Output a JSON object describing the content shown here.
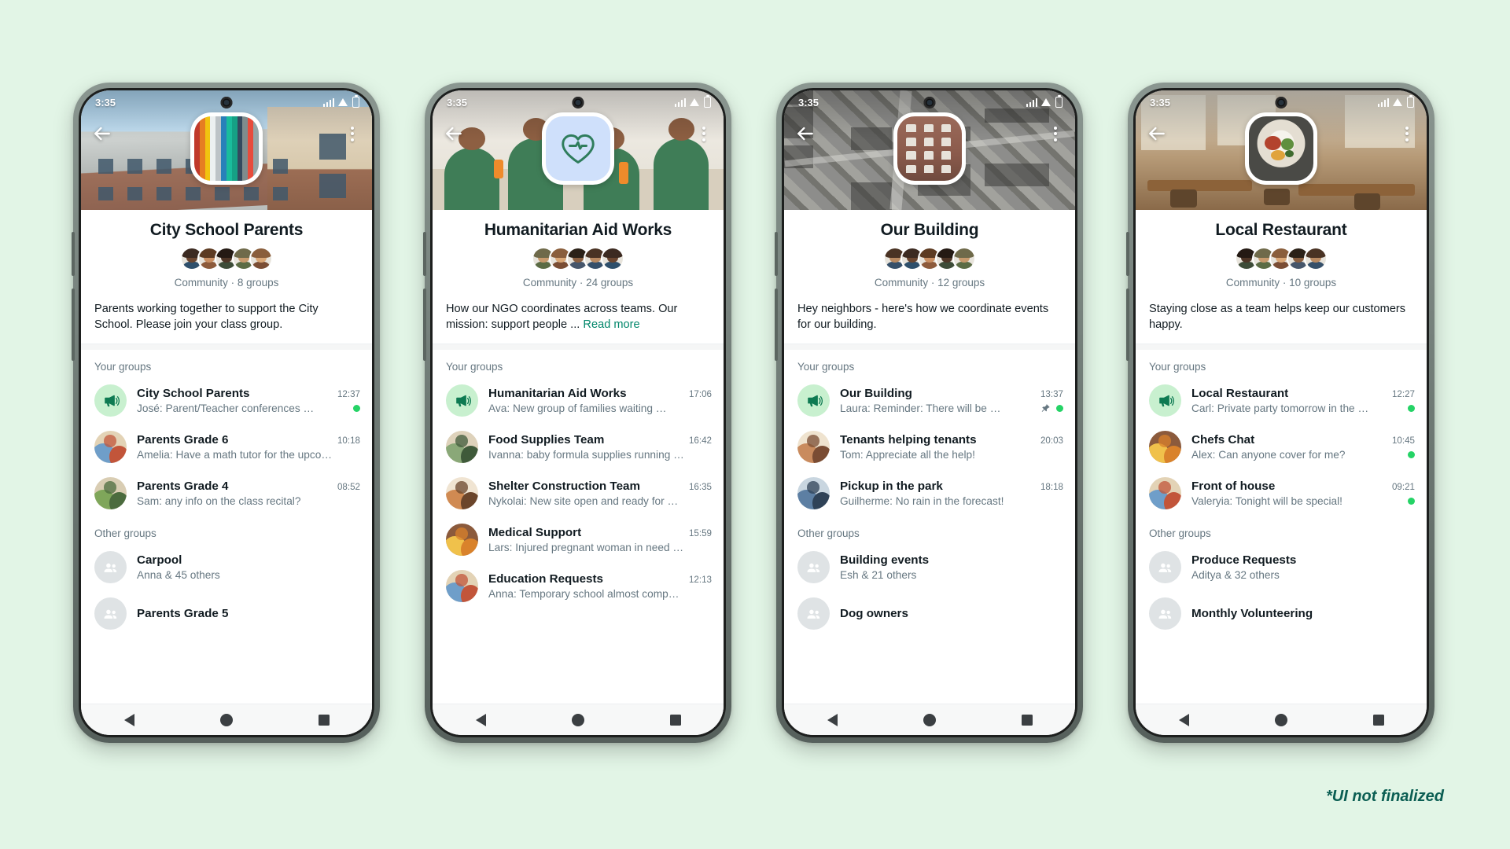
{
  "page": {
    "background_color": "#e2f5e6",
    "disclaimer": "*UI not finalized"
  },
  "status_bar": {
    "time_1": "3:35",
    "time_2": "3:35",
    "time_3": "3:35",
    "time_4": "3:35"
  },
  "icons": {
    "back": "back-arrow-icon",
    "more": "overflow-menu-icon",
    "announce": "megaphone-icon",
    "pin": "pin-icon",
    "group": "group-people-icon",
    "unread": "unread-dot"
  },
  "colors": {
    "accent_green": "#00866a",
    "unread_dot": "#25d366",
    "announce_bg": "#c8f0cf",
    "secondary_text": "#667781",
    "primary_text": "#111b21"
  },
  "labels": {
    "your_groups": "Your groups",
    "other_groups": "Other groups",
    "read_more": "Read more"
  },
  "phones": [
    {
      "id": "city-school-parents",
      "title": "City School Parents",
      "subtitle": "Community · 8 groups",
      "description": "Parents working together to support the City School. Please join your class group.",
      "has_read_more": false,
      "your_groups": [
        {
          "name": "City School Parents",
          "message": "José: Parent/Teacher conferences …",
          "time": "12:37",
          "announce": true,
          "pinned": false,
          "unread": true
        },
        {
          "name": "Parents Grade 6",
          "message": "Amelia: Have a math tutor for the upco…",
          "time": "10:18",
          "announce": false,
          "pinned": false,
          "unread": false
        },
        {
          "name": "Parents Grade 4",
          "message": "Sam: any info on the class recital?",
          "time": "08:52",
          "announce": false,
          "pinned": false,
          "unread": false
        }
      ],
      "other_groups": [
        {
          "name": "Carpool",
          "members": "Anna & 45 others"
        },
        {
          "name": "Parents Grade 5",
          "members": ""
        }
      ]
    },
    {
      "id": "humanitarian-aid-works",
      "title": "Humanitarian Aid Works",
      "subtitle": "Community · 24 groups",
      "description": "How our NGO coordinates across teams. Our mission: support people ...",
      "has_read_more": true,
      "your_groups": [
        {
          "name": "Humanitarian Aid Works",
          "message": "Ava: New group of families waiting …",
          "time": "17:06",
          "announce": true,
          "pinned": false,
          "unread": false
        },
        {
          "name": "Food Supplies Team",
          "message": "Ivanna: baby formula supplies running …",
          "time": "16:42",
          "announce": false,
          "pinned": false,
          "unread": false
        },
        {
          "name": "Shelter Construction Team",
          "message": "Nykolai: New site open and ready for …",
          "time": "16:35",
          "announce": false,
          "pinned": false,
          "unread": false
        },
        {
          "name": "Medical Support",
          "message": "Lars: Injured pregnant woman in need …",
          "time": "15:59",
          "announce": false,
          "pinned": false,
          "unread": false
        },
        {
          "name": "Education Requests",
          "message": "Anna: Temporary school almost comp…",
          "time": "12:13",
          "announce": false,
          "pinned": false,
          "unread": false
        }
      ],
      "other_groups": []
    },
    {
      "id": "our-building",
      "title": "Our Building",
      "subtitle": "Community · 12 groups",
      "description": "Hey neighbors - here's how we coordinate events for our building.",
      "has_read_more": false,
      "your_groups": [
        {
          "name": "Our Building",
          "message": "Laura: Reminder:  There will be …",
          "time": "13:37",
          "announce": true,
          "pinned": true,
          "unread": true
        },
        {
          "name": "Tenants helping tenants",
          "message": "Tom: Appreciate all the help!",
          "time": "20:03",
          "announce": false,
          "pinned": false,
          "unread": false
        },
        {
          "name": "Pickup in the park",
          "message": "Guilherme: No rain in the forecast!",
          "time": "18:18",
          "announce": false,
          "pinned": false,
          "unread": false
        }
      ],
      "other_groups": [
        {
          "name": "Building events",
          "members": "Esh & 21 others"
        },
        {
          "name": "Dog owners",
          "members": ""
        }
      ]
    },
    {
      "id": "local-restaurant",
      "title": "Local Restaurant",
      "subtitle": "Community · 10 groups",
      "description": "Staying close as a team helps keep our customers happy.",
      "has_read_more": false,
      "your_groups": [
        {
          "name": "Local Restaurant",
          "message": "Carl: Private party tomorrow in the …",
          "time": "12:27",
          "announce": true,
          "pinned": false,
          "unread": true
        },
        {
          "name": "Chefs Chat",
          "message": "Alex: Can anyone cover for me?",
          "time": "10:45",
          "announce": false,
          "pinned": false,
          "unread": true
        },
        {
          "name": "Front of house",
          "message": "Valeryia: Tonight will be special!",
          "time": "09:21",
          "announce": false,
          "pinned": false,
          "unread": true
        }
      ],
      "other_groups": [
        {
          "name": "Produce Requests",
          "members": "Aditya & 32 others"
        },
        {
          "name": "Monthly Volunteering",
          "members": ""
        }
      ]
    }
  ]
}
